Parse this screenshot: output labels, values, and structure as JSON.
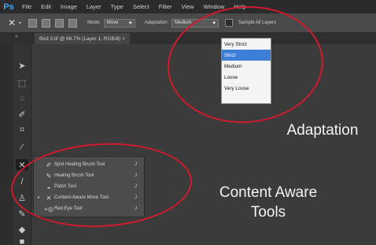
{
  "app": {
    "logo": "Ps"
  },
  "menu": [
    "File",
    "Edit",
    "Image",
    "Layer",
    "Type",
    "Select",
    "Filter",
    "View",
    "Window",
    "Help"
  ],
  "options": {
    "tool_icon": "content-aware-move-icon",
    "mode_label": "Mode:",
    "mode_value": "Move",
    "adaptation_label": "Adaptation:",
    "adaptation_value": "Medium",
    "sample_all_label": "Sample All Layers"
  },
  "document": {
    "tab_title": "Bird 3.tif @ 66.7% (Layer 1, RGB/8) ×"
  },
  "adaptation_dropdown": {
    "items": [
      "Very Strict",
      "Strict",
      "Medium",
      "Loose",
      "Very Loose"
    ],
    "selected": "Strict"
  },
  "tool_flyout": {
    "items": [
      {
        "label": "Spot Healing Brush Tool",
        "key": "J",
        "icon": "spot-healing-brush-icon"
      },
      {
        "label": "Healing Brush Tool",
        "key": "J",
        "icon": "healing-brush-icon"
      },
      {
        "label": "Patch Tool",
        "key": "J",
        "icon": "patch-icon"
      },
      {
        "label": "Content-Aware Move Tool",
        "key": "J",
        "icon": "content-aware-move-icon",
        "selected": true
      },
      {
        "label": "Red Eye Tool",
        "key": "J",
        "icon": "red-eye-icon"
      }
    ]
  },
  "annotations": {
    "adaptation": "Adaptation",
    "content_aware_line1": "Content Aware",
    "content_aware_line2": "Tools"
  },
  "colors": {
    "highlight_ring": "#d01a2c",
    "selection": "#3d7fd6",
    "ps_blue": "#31a8ff"
  }
}
